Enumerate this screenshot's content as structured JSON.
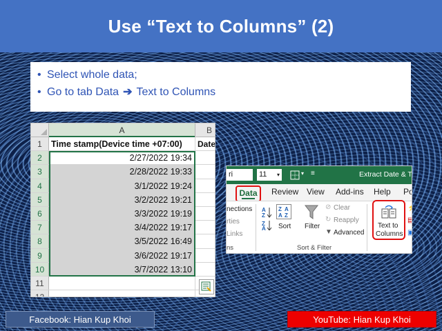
{
  "slide": {
    "title": "Use “Text to Columns” (2)",
    "bullets": {
      "line1": "Select whole data;",
      "line2_prefix": "Go to tab Data",
      "line2_arrow": "➔",
      "line2_suffix": "Text to Columns"
    }
  },
  "sheet": {
    "columns": [
      "A",
      "B"
    ],
    "header_cell": "Time stamp(Device time +07:00)",
    "col_b_header": "Date",
    "rows": [
      {
        "num": "2",
        "value": "2/27/2022 19:34"
      },
      {
        "num": "3",
        "value": "2/28/2022 19:33"
      },
      {
        "num": "4",
        "value": "3/1/2022 19:24"
      },
      {
        "num": "5",
        "value": "3/2/2022 19:21"
      },
      {
        "num": "6",
        "value": "3/3/2022 19:19"
      },
      {
        "num": "7",
        "value": "3/4/2022 19:17"
      },
      {
        "num": "8",
        "value": "3/5/2022 16:49"
      },
      {
        "num": "9",
        "value": "3/6/2022 19:17"
      },
      {
        "num": "10",
        "value": "3/7/2022 13:10"
      }
    ],
    "row_labels": [
      "1",
      "11",
      "12"
    ]
  },
  "ribbon": {
    "font_name": "ri",
    "font_size": "11",
    "window_title": "Extract Date & Time",
    "tabs": [
      "Data",
      "Review",
      "View",
      "Add-ins",
      "Help",
      "Po"
    ],
    "connections": [
      "nections",
      "rties",
      "Links"
    ],
    "connections_group": "ns",
    "sort_label": "Sort",
    "filter_label": "Filter",
    "clear_label": "Clear",
    "reapply_label": "Reapply",
    "advanced_label": "Advanced",
    "sort_filter_group": "Sort & Filter",
    "ttc_line1": "Text to",
    "ttc_line2": "Columns",
    "sort_az": "A Z",
    "sort_za": "Z A"
  },
  "footer": {
    "facebook": "Facebook: Hian Kup Khoi",
    "youtube": "YouTube: Hian Kup Khoi"
  },
  "colors": {
    "title_bar": "#4472c4",
    "bullet_text": "#2f54b5",
    "excel_green": "#217346",
    "highlight_red": "#e01010",
    "youtube_red": "#ee0000",
    "facebook_blue": "#3d5a8c"
  }
}
